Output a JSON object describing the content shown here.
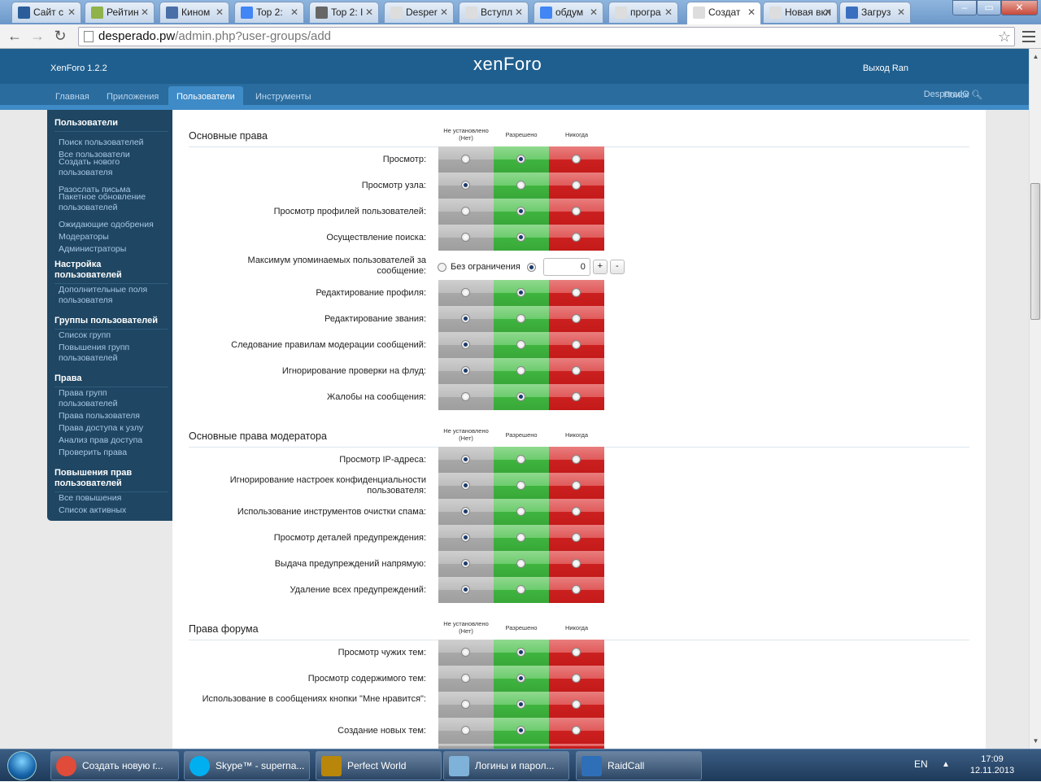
{
  "browser": {
    "tabs": [
      {
        "label": "Сайт с",
        "color": "#2a5d9a"
      },
      {
        "label": "Рейтин",
        "color": "#8fb24a"
      },
      {
        "label": "Кином",
        "color": "#4a6ea8"
      },
      {
        "label": "Top 2:",
        "color": "#4285f4"
      },
      {
        "label": "Top 2: I",
        "color": "#666666"
      },
      {
        "label": "Desper",
        "color": "#dddddd"
      },
      {
        "label": "Вступл",
        "color": "#dddddd"
      },
      {
        "label": "обдум",
        "color": "#4285f4"
      },
      {
        "label": "програ",
        "color": "#dddddd"
      },
      {
        "label": "Создат",
        "color": "#dddddd"
      },
      {
        "label": "Новая вкл",
        "color": "#dddddd"
      },
      {
        "label": "Загруз",
        "color": "#3a6fc0"
      }
    ],
    "url_host": "desperado.pw",
    "url_path": "/admin.php?user-groups/add"
  },
  "header": {
    "version": "XenForo 1.2.2",
    "logo": "xenForo",
    "logout": "Выход Ran"
  },
  "nav": {
    "tabs": [
      "Главная",
      "Приложения",
      "Пользователи",
      "Инструменты"
    ],
    "user": "DesperadO",
    "search": "Поиск"
  },
  "sidebar": [
    {
      "title": "Пользователи",
      "items": [
        "Поиск пользователей",
        "Все пользователи",
        "Создать нового пользователя",
        "Разослать письма",
        "Пакетное обновление пользователей",
        "Ожидающие одобрения",
        "Модераторы",
        "Администраторы"
      ]
    },
    {
      "title": "Настройка пользователей",
      "items": [
        "Дополнительные поля пользователя"
      ]
    },
    {
      "title": "Группы пользователей",
      "items": [
        "Список групп",
        "Повышения групп пользователей"
      ]
    },
    {
      "title": "Права",
      "items": [
        "Права групп пользователей",
        "Права пользователя",
        "Права доступа к узлу",
        "Анализ прав доступа",
        "Проверить права"
      ]
    },
    {
      "title": "Повышения прав пользователей",
      "items": [
        "Все повышения",
        "Список активных"
      ]
    }
  ],
  "columns": {
    "unset": "Не установлено (Нет)",
    "allow": "Разрешено",
    "never": "Никогда"
  },
  "sections": [
    {
      "title": "Основные права",
      "rows": [
        {
          "label": "Просмотр:",
          "value": "allow"
        },
        {
          "label": "Просмотр узла:",
          "value": "unset"
        },
        {
          "label": "Просмотр профилей пользователей:",
          "value": "allow"
        },
        {
          "label": "Осуществление поиска:",
          "value": "allow"
        },
        {
          "label": "Максимум упоминаемых пользователей за сообщение:",
          "type": "max",
          "unlimited_label": "Без ограничения",
          "value": "0"
        },
        {
          "label": "Редактирование профиля:",
          "value": "allow"
        },
        {
          "label": "Редактирование звания:",
          "value": "unset"
        },
        {
          "label": "Следование правилам модерации сообщений:",
          "value": "unset"
        },
        {
          "label": "Игнорирование проверки на флуд:",
          "value": "unset"
        },
        {
          "label": "Жалобы на сообщения:",
          "value": "allow"
        }
      ]
    },
    {
      "title": "Основные права модератора",
      "rows": [
        {
          "label": "Просмотр IP-адреса:",
          "value": "unset"
        },
        {
          "label": "Игнорирование настроек конфиденциальности пользователя:",
          "value": "unset"
        },
        {
          "label": "Использование инструментов очистки спама:",
          "value": "unset"
        },
        {
          "label": "Просмотр деталей предупреждения:",
          "value": "unset"
        },
        {
          "label": "Выдача предупреждений напрямую:",
          "value": "unset"
        },
        {
          "label": "Удаление всех предупреждений:",
          "value": "unset"
        }
      ]
    },
    {
      "title": "Права форума",
      "rows": [
        {
          "label": "Просмотр чужих тем:",
          "value": "allow"
        },
        {
          "label": "Просмотр содержимого тем:",
          "value": "allow"
        },
        {
          "label": "Использование в сообщениях кнопки \"Мне нравится\":",
          "value": "allow"
        },
        {
          "label": "Создание новых тем:",
          "value": "allow"
        },
        {
          "label": "",
          "value": "none"
        }
      ]
    }
  ],
  "taskbar": {
    "items": [
      {
        "label": "Создать новую г...",
        "color": "#e04b3a"
      },
      {
        "label": "Skype™ - superna...",
        "color": "#00aff0"
      },
      {
        "label": "Perfect World",
        "color": "#b8860b"
      },
      {
        "label": "Логины и парол...",
        "color": "#7fb2d8"
      },
      {
        "label": "RaidCall",
        "color": "#2f6fb8"
      }
    ],
    "lang": "EN",
    "time": "17:09",
    "date": "12.11.2013"
  }
}
